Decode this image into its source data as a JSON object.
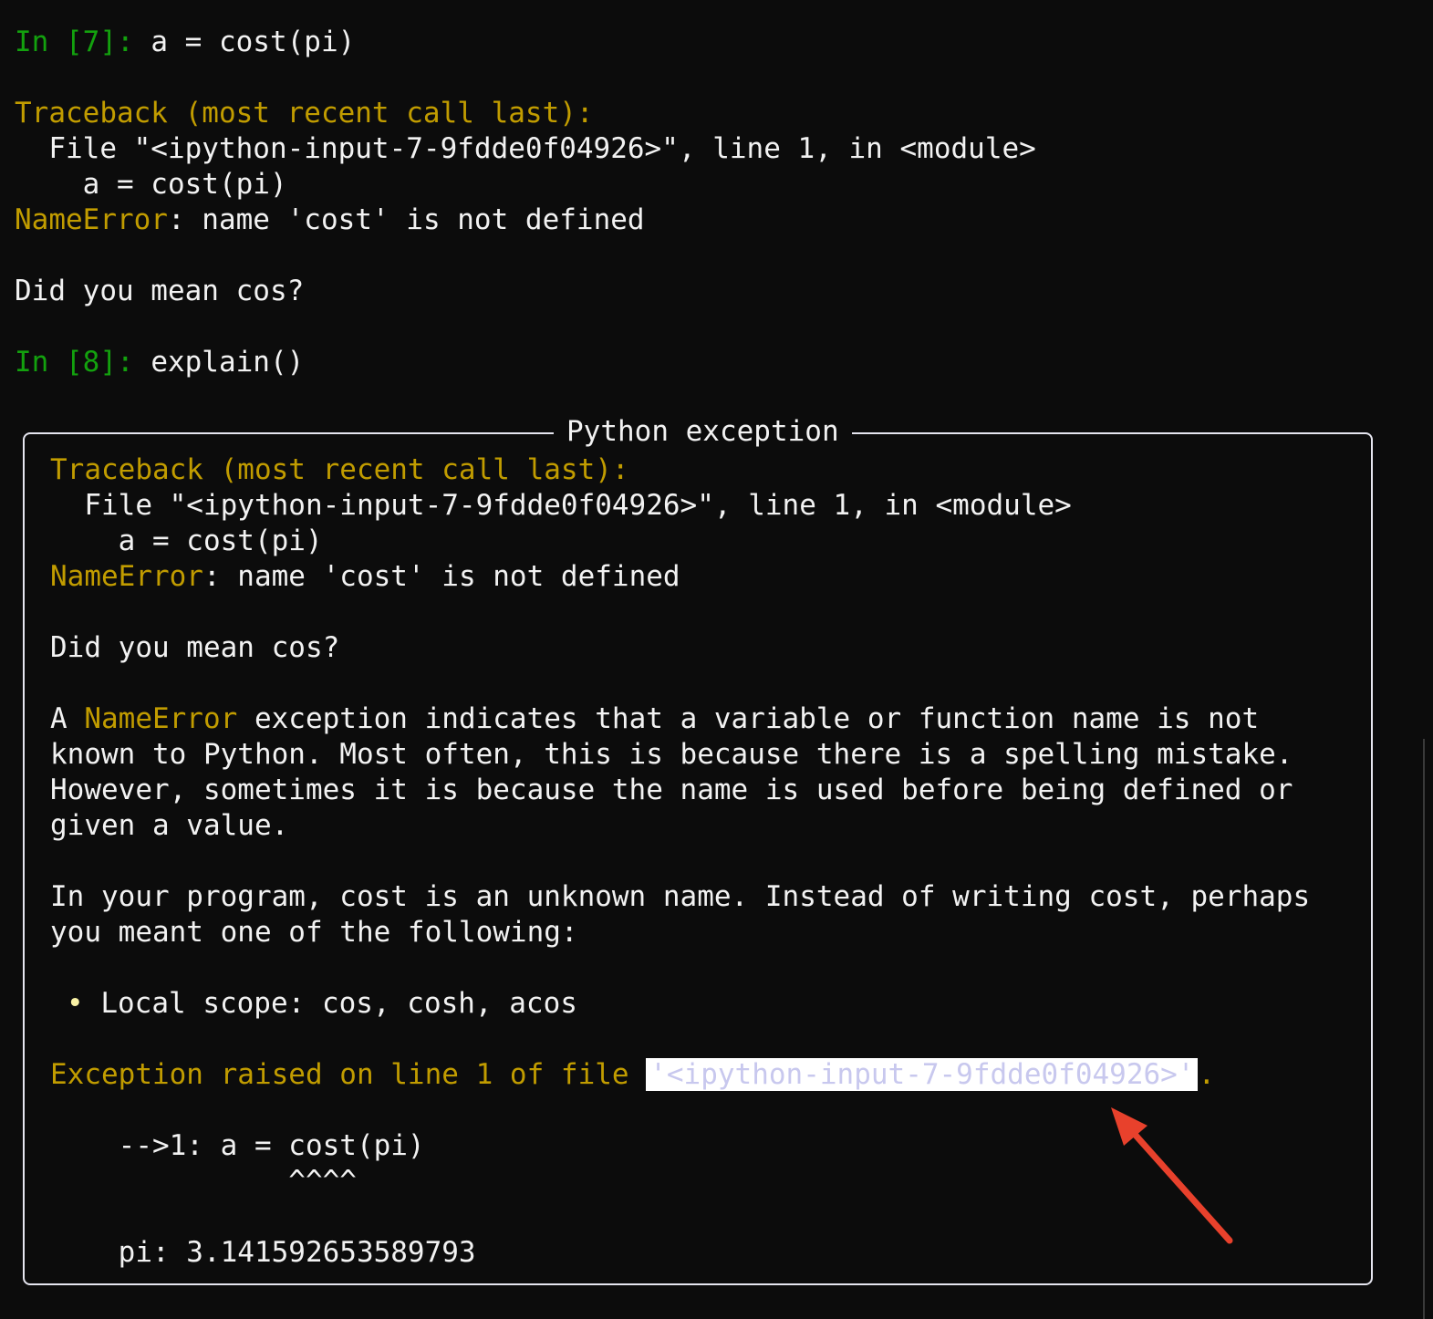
{
  "top": {
    "in7_prompt": "In [7]:",
    "in7_code": " a = cost(pi)",
    "traceback_header": "Traceback (most recent call last):",
    "file_line": "  File \"<ipython-input-7-9fdde0f04926>\", line 1, in <module>",
    "code_line": "    a = cost(pi)",
    "error_name": "NameError",
    "error_msg": ": name 'cost' is not defined",
    "hint": "Did you mean cos?",
    "in8_prompt": "In [8]:",
    "in8_code": " explain()"
  },
  "panel": {
    "title": "Python exception",
    "traceback_header": "Traceback (most recent call last):",
    "file_line": "  File \"<ipython-input-7-9fdde0f04926>\", line 1, in <module>",
    "code_line": "    a = cost(pi)",
    "error_name": "NameError",
    "error_msg": ": name 'cost' is not defined",
    "hint": "Did you mean cos?",
    "explain_1_pre": "A ",
    "explain_1_name": "NameError",
    "explain_1_post": " exception indicates that a variable or function name is not",
    "explain_2": "known to Python. Most often, this is because there is a spelling mistake.",
    "explain_3": "However, sometimes it is because the name is used before being defined or",
    "explain_4": "given a value.",
    "program_1": "In your program, cost is an unknown name. Instead of writing cost, perhaps",
    "program_2": "you meant one of the following:",
    "bullet": "•",
    "scope": " Local scope: cos, cosh, acos",
    "exception_raised": "Exception raised on line 1 of file ",
    "file_highlight": "'<ipython-input-7-9fdde0f04926>'",
    "period": ".",
    "arrow_line": "    -->1: a = cost(pi)",
    "caret_line": "              ^^^^",
    "pi_value": "    pi: 3.141592653589793"
  },
  "colors": {
    "prompt": "#13a10e",
    "traceback": "#c19c00",
    "text": "#f2f2f2",
    "annotation_arrow": "#e8412c"
  }
}
